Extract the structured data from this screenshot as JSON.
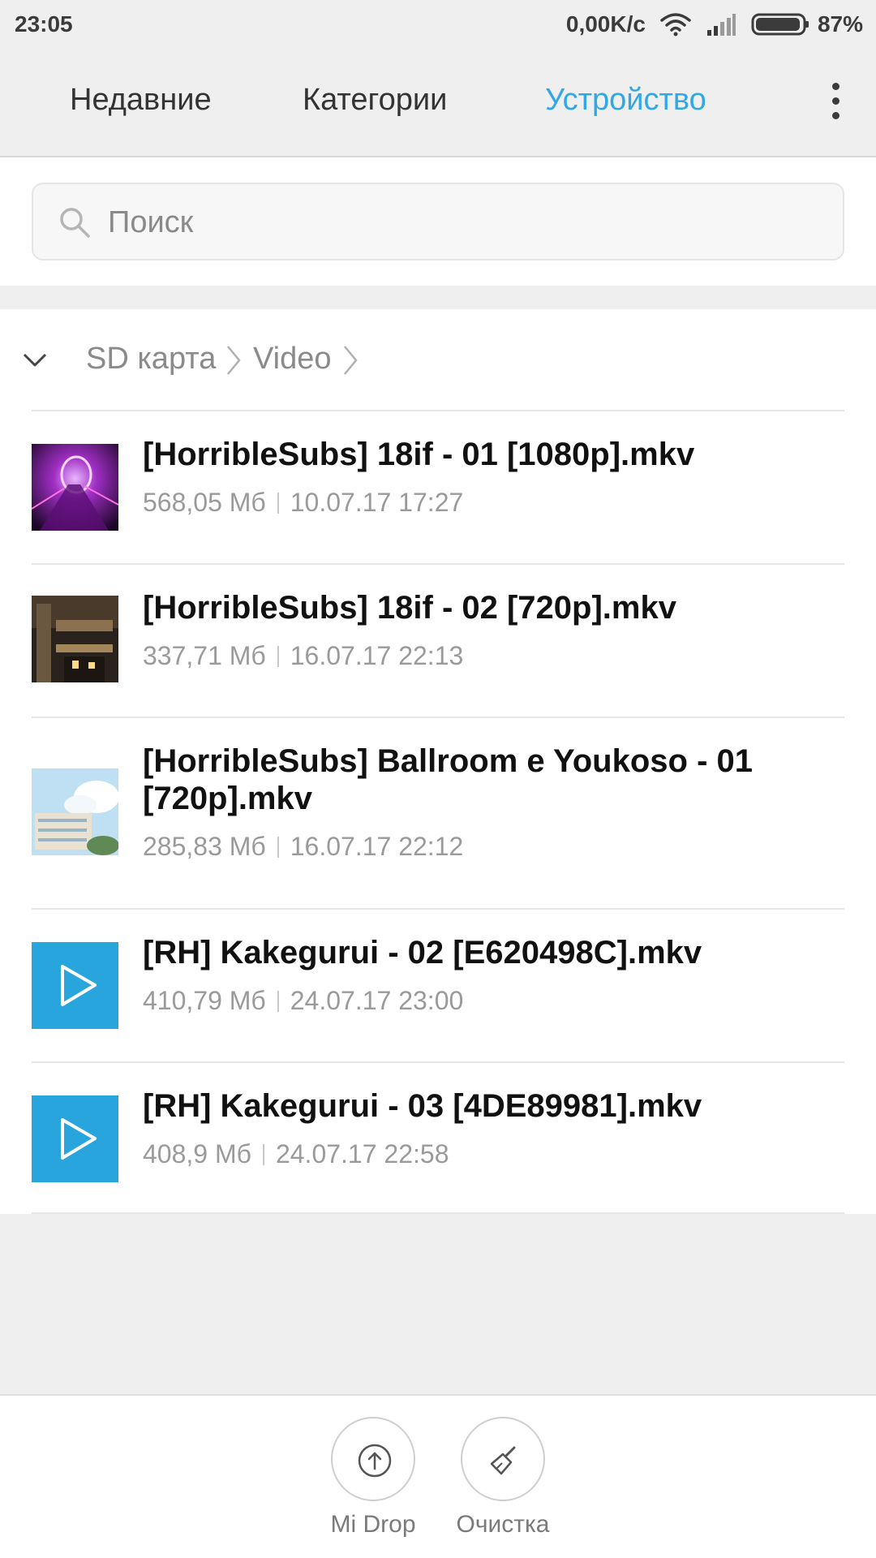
{
  "status_bar": {
    "time": "23:05",
    "net_speed": "0,00K/c",
    "battery": "87%"
  },
  "tabs": [
    {
      "label": "Недавние",
      "active": false
    },
    {
      "label": "Категории",
      "active": false
    },
    {
      "label": "Устройство",
      "active": true
    }
  ],
  "accent_color": "#30a8e6",
  "search": {
    "placeholder": "Поиск",
    "value": ""
  },
  "breadcrumb": [
    "SD карта",
    "Video"
  ],
  "files": [
    {
      "name": "[HorribleSubs] 18if - 01 [1080p].mkv",
      "size": "568,05 Мб",
      "date": "10.07.17 17:27",
      "thumb": "purple-anime-thumbnail"
    },
    {
      "name": "[HorribleSubs] 18if - 02 [720p].mkv",
      "size": "337,71 Мб",
      "date": "16.07.17 22:13",
      "thumb": "city-night-thumbnail"
    },
    {
      "name": "[HorribleSubs] Ballroom e Youkoso - 01 [720p].mkv",
      "size": "285,83 Мб",
      "date": "16.07.17 22:12",
      "thumb": "school-sky-thumbnail"
    },
    {
      "name": "[RH] Kakegurui - 02 [E620498C].mkv",
      "size": "410,79 Мб",
      "date": "24.07.17 23:00",
      "thumb": "play-icon"
    },
    {
      "name": "[RH] Kakegurui - 03 [4DE89981].mkv",
      "size": "408,9 Мб",
      "date": "24.07.17 22:58",
      "thumb": "play-icon"
    }
  ],
  "bottom": {
    "mi_drop": "Mi Drop",
    "cleanup": "Очистка"
  }
}
